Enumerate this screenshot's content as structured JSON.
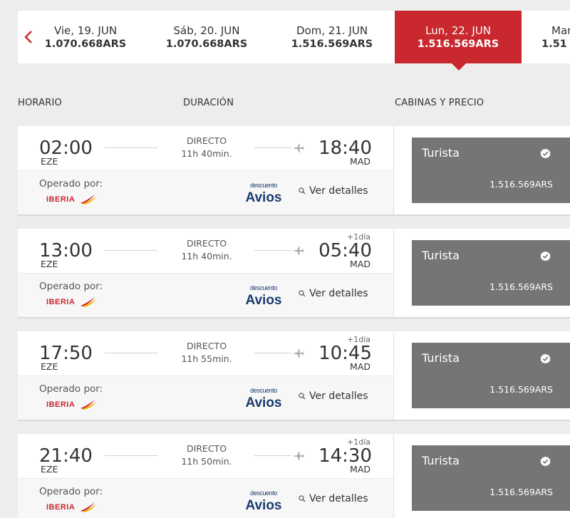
{
  "dates": [
    {
      "label": "Vie, 19. JUN",
      "price": "1.070.668ARS",
      "selected": false
    },
    {
      "label": "Sáb, 20. JUN",
      "price": "1.070.668ARS",
      "selected": false
    },
    {
      "label": "Dom, 21. JUN",
      "price": "1.516.569ARS",
      "selected": false
    },
    {
      "label": "Lun, 22. JUN",
      "price": "1.516.569ARS",
      "selected": true
    },
    {
      "label": "Mar",
      "price": "1.51",
      "selected": false
    }
  ],
  "headers": {
    "schedule": "HORARIO",
    "duration": "DURACIÓN",
    "cabins": "CABINAS Y PRECIO"
  },
  "flights": [
    {
      "dep_time": "02:00",
      "dep_code": "EZE",
      "route": "DIRECTO",
      "duration": "11h 40min.",
      "next_day": "",
      "arr_time": "18:40",
      "arr_code": "MAD",
      "operated_label": "Operado por:",
      "details_label": "Ver detalles",
      "cabin": "Turista",
      "price": "1.516.569ARS"
    },
    {
      "dep_time": "13:00",
      "dep_code": "EZE",
      "route": "DIRECTO",
      "duration": "11h 40min.",
      "next_day": "+1día",
      "arr_time": "05:40",
      "arr_code": "MAD",
      "operated_label": "Operado por:",
      "details_label": "Ver detalles",
      "cabin": "Turista",
      "price": "1.516.569ARS"
    },
    {
      "dep_time": "17:50",
      "dep_code": "EZE",
      "route": "DIRECTO",
      "duration": "11h 55min.",
      "next_day": "+1día",
      "arr_time": "10:45",
      "arr_code": "MAD",
      "operated_label": "Operado por:",
      "details_label": "Ver detalles",
      "cabin": "Turista",
      "price": "1.516.569ARS"
    },
    {
      "dep_time": "21:40",
      "dep_code": "EZE",
      "route": "DIRECTO",
      "duration": "11h 50min.",
      "next_day": "+1día",
      "arr_time": "14:30",
      "arr_code": "MAD",
      "operated_label": "Operado por:",
      "details_label": "Ver detalles",
      "cabin": "Turista",
      "price": "1.516.569ARS"
    }
  ],
  "branding": {
    "airline": "IBERIA",
    "promo_top": "descuento",
    "promo_main": "Avios"
  },
  "colors": {
    "accent": "#c8282e",
    "fare_bg": "#757575",
    "avios_blue": "#1b3b6f",
    "iberia_yellow": "#f2b705"
  },
  "icons": {
    "prev": "chevron-left-icon",
    "plane": "plane-icon",
    "search": "magnifier-icon",
    "check": "check-badge-icon"
  }
}
